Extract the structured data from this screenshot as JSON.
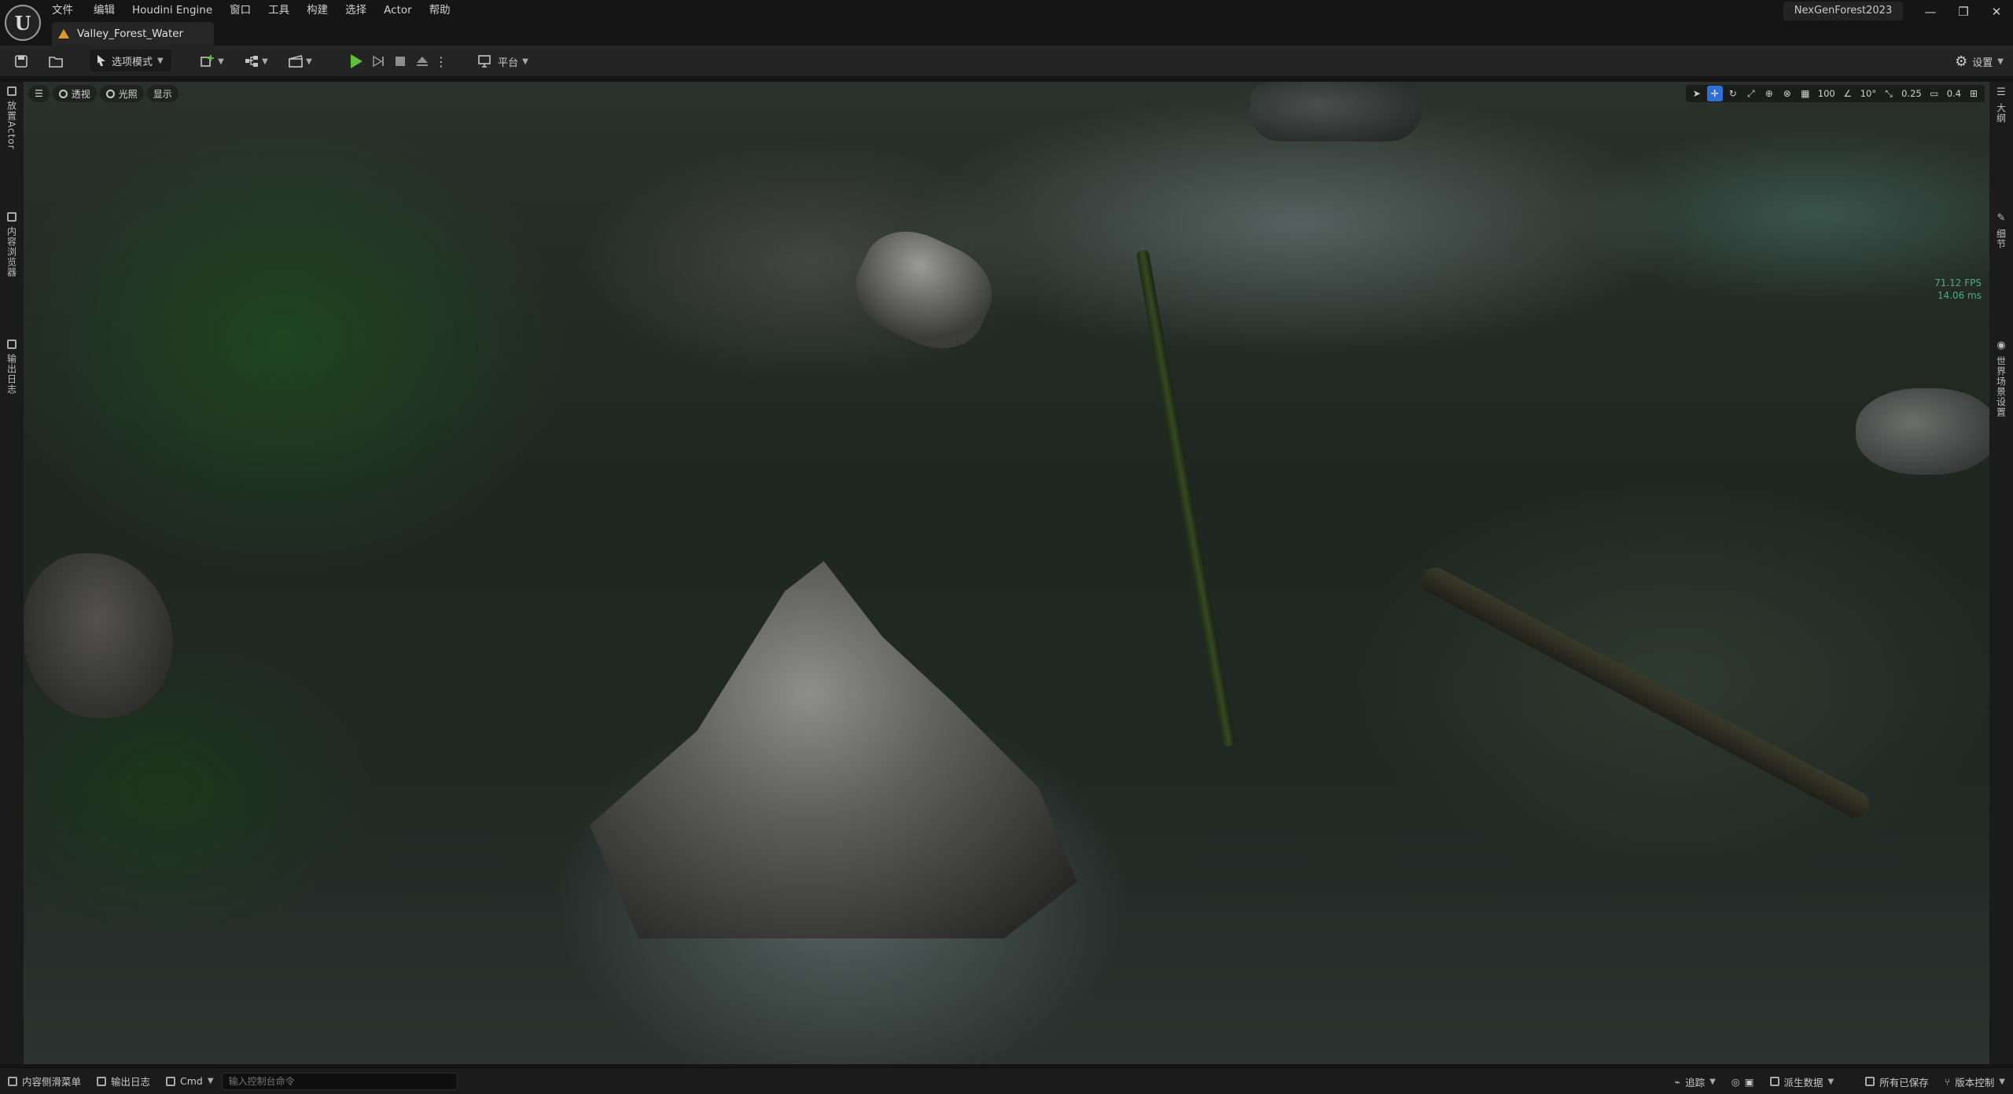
{
  "app": {
    "project_name": "NexGenForest2023",
    "document_tab": "Valley_Forest_Water",
    "logo_glyph": "U"
  },
  "menu": [
    "文件",
    "编辑",
    "Houdini Engine",
    "窗口",
    "工具",
    "构建",
    "选择",
    "Actor",
    "帮助"
  ],
  "window_controls": {
    "minimize": "—",
    "restore": "❐",
    "close": "✕"
  },
  "toolbar": {
    "mode_label": "选项模式",
    "platform_label": "平台",
    "settings_label": "设置"
  },
  "left_tabs": [
    "放置Actor",
    "内容浏览器",
    "输出日志"
  ],
  "right_tabs": [
    "大纲",
    "细节",
    "世界场景设置"
  ],
  "viewport": {
    "view_chip": "透视",
    "lit_chip": "光照",
    "show_chip": "显示",
    "grid_snap": "100",
    "rot_snap": "10°",
    "scale_snap": "0.25",
    "camera_speed": "0.4",
    "fps": "71.12 FPS",
    "frame_ms": "14.06 ms"
  },
  "statusbar": {
    "content_drawer": "内容侧滑菜单",
    "output_log": "输出日志",
    "cmd_label": "Cmd",
    "cmd_placeholder": "输入控制台命令",
    "trace": "追踪",
    "derived_data": "派生数据",
    "all_saved": "所有已保存",
    "source_control": "版本控制"
  },
  "colors": {
    "play_green": "#5fbf3a",
    "accent_blue": "#2f6fd6",
    "fps_green": "#4fa88e",
    "level_icon_orange": "#d99a2b"
  }
}
